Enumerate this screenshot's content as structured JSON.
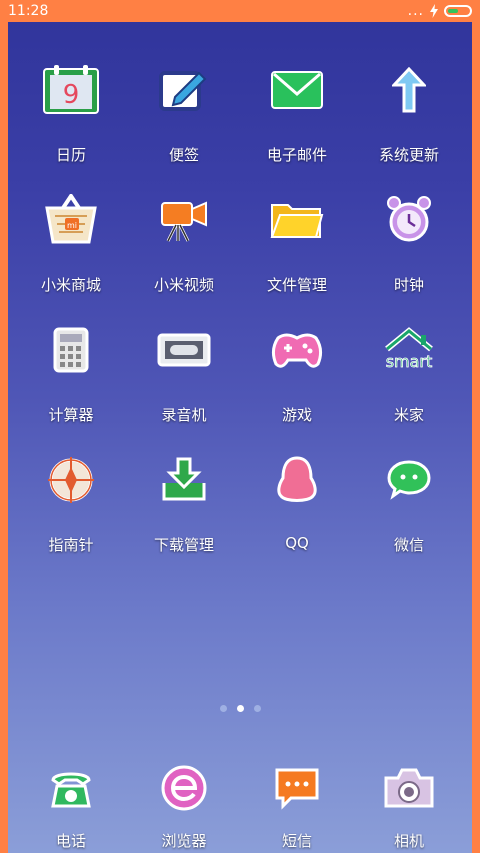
{
  "status": {
    "time": "11:28",
    "signal_dots": "...",
    "charging_icon": "lightning",
    "battery_color": "#32c35b"
  },
  "apps": [
    {
      "label": "日历",
      "icon": "calendar-icon",
      "calendar_day": "9"
    },
    {
      "label": "便签",
      "icon": "notes-icon"
    },
    {
      "label": "电子邮件",
      "icon": "mail-icon"
    },
    {
      "label": "系统更新",
      "icon": "update-arrow-icon"
    },
    {
      "label": "小米商城",
      "icon": "shopping-basket-icon",
      "badge": "mi"
    },
    {
      "label": "小米视频",
      "icon": "video-camera-icon"
    },
    {
      "label": "文件管理",
      "icon": "folder-icon"
    },
    {
      "label": "时钟",
      "icon": "alarm-clock-icon"
    },
    {
      "label": "计算器",
      "icon": "calculator-icon"
    },
    {
      "label": "录音机",
      "icon": "recorder-icon"
    },
    {
      "label": "游戏",
      "icon": "gamepad-icon"
    },
    {
      "label": "米家",
      "icon": "smart-home-icon",
      "badge": "smart"
    },
    {
      "label": "指南针",
      "icon": "compass-icon"
    },
    {
      "label": "下载管理",
      "icon": "download-icon"
    },
    {
      "label": "QQ",
      "icon": "qq-penguin-icon"
    },
    {
      "label": "微信",
      "icon": "wechat-icon"
    }
  ],
  "pager": {
    "count": 3,
    "active_index": 1
  },
  "dock": [
    {
      "label": "电话",
      "icon": "phone-icon"
    },
    {
      "label": "浏览器",
      "icon": "browser-icon"
    },
    {
      "label": "短信",
      "icon": "message-icon"
    },
    {
      "label": "相机",
      "icon": "camera-icon"
    }
  ]
}
